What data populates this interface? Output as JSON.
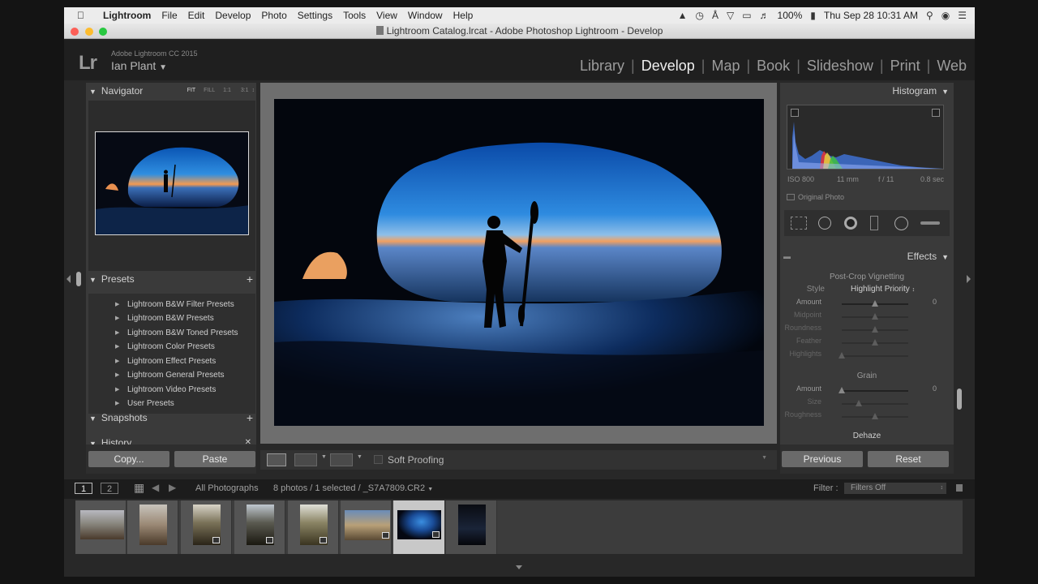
{
  "menubar": {
    "app": "Lightroom",
    "items": [
      "File",
      "Edit",
      "Develop",
      "Photo",
      "Settings",
      "Tools",
      "View",
      "Window",
      "Help"
    ],
    "battery": "100%",
    "clock": "Thu Sep 28  10:31 AM"
  },
  "window": {
    "title": "Lightroom Catalog.lrcat - Adobe Photoshop Lightroom - Develop"
  },
  "header": {
    "logo": "Lr",
    "product": "Adobe Lightroom CC 2015",
    "user": "Ian Plant",
    "modules": [
      "Library",
      "Develop",
      "Map",
      "Book",
      "Slideshow",
      "Print",
      "Web"
    ],
    "active_module": "Develop"
  },
  "left": {
    "navigator": {
      "title": "Navigator",
      "zoom": [
        "FIT",
        "FILL",
        "1:1",
        "3:1"
      ]
    },
    "presets": {
      "title": "Presets",
      "items": [
        "Lightroom B&W Filter Presets",
        "Lightroom B&W Presets",
        "Lightroom B&W Toned Presets",
        "Lightroom Color Presets",
        "Lightroom Effect Presets",
        "Lightroom General Presets",
        "Lightroom Video Presets",
        "User Presets"
      ]
    },
    "snapshots": "Snapshots",
    "history": "History",
    "copy_btn": "Copy...",
    "paste_btn": "Paste"
  },
  "toolbar": {
    "soft_proofing": "Soft Proofing"
  },
  "right": {
    "histogram": {
      "title": "Histogram",
      "iso": "ISO 800",
      "focal": "11 mm",
      "aperture": "f / 11",
      "shutter": "0.8 sec",
      "original_photo": "Original Photo"
    },
    "effects": {
      "title": "Effects",
      "vignette_title": "Post-Crop Vignetting",
      "style_label": "Style",
      "style_value": "Highlight Priority",
      "vignette_sliders": [
        {
          "label": "Amount",
          "value": "0",
          "pos": 0.5
        },
        {
          "label": "Midpoint",
          "value": "",
          "pos": 0.5
        },
        {
          "label": "Roundness",
          "value": "",
          "pos": 0.5
        },
        {
          "label": "Feather",
          "value": "",
          "pos": 0.5
        },
        {
          "label": "Highlights",
          "value": "",
          "pos": 0.0
        }
      ],
      "grain_title": "Grain",
      "grain_sliders": [
        {
          "label": "Amount",
          "value": "0",
          "pos": 0.0
        },
        {
          "label": "Size",
          "value": "",
          "pos": 0.25
        },
        {
          "label": "Roughness",
          "value": "",
          "pos": 0.5
        }
      ],
      "dehaze_title": "Dehaze"
    },
    "previous_btn": "Previous",
    "reset_btn": "Reset"
  },
  "filmstrip": {
    "page1": "1",
    "page2": "2",
    "source": "All Photographs",
    "count": "8 photos / 1 selected / _S7A7809.CR2",
    "filter_label": "Filter :",
    "filter_value": "Filters Off",
    "selected_index": 6
  }
}
